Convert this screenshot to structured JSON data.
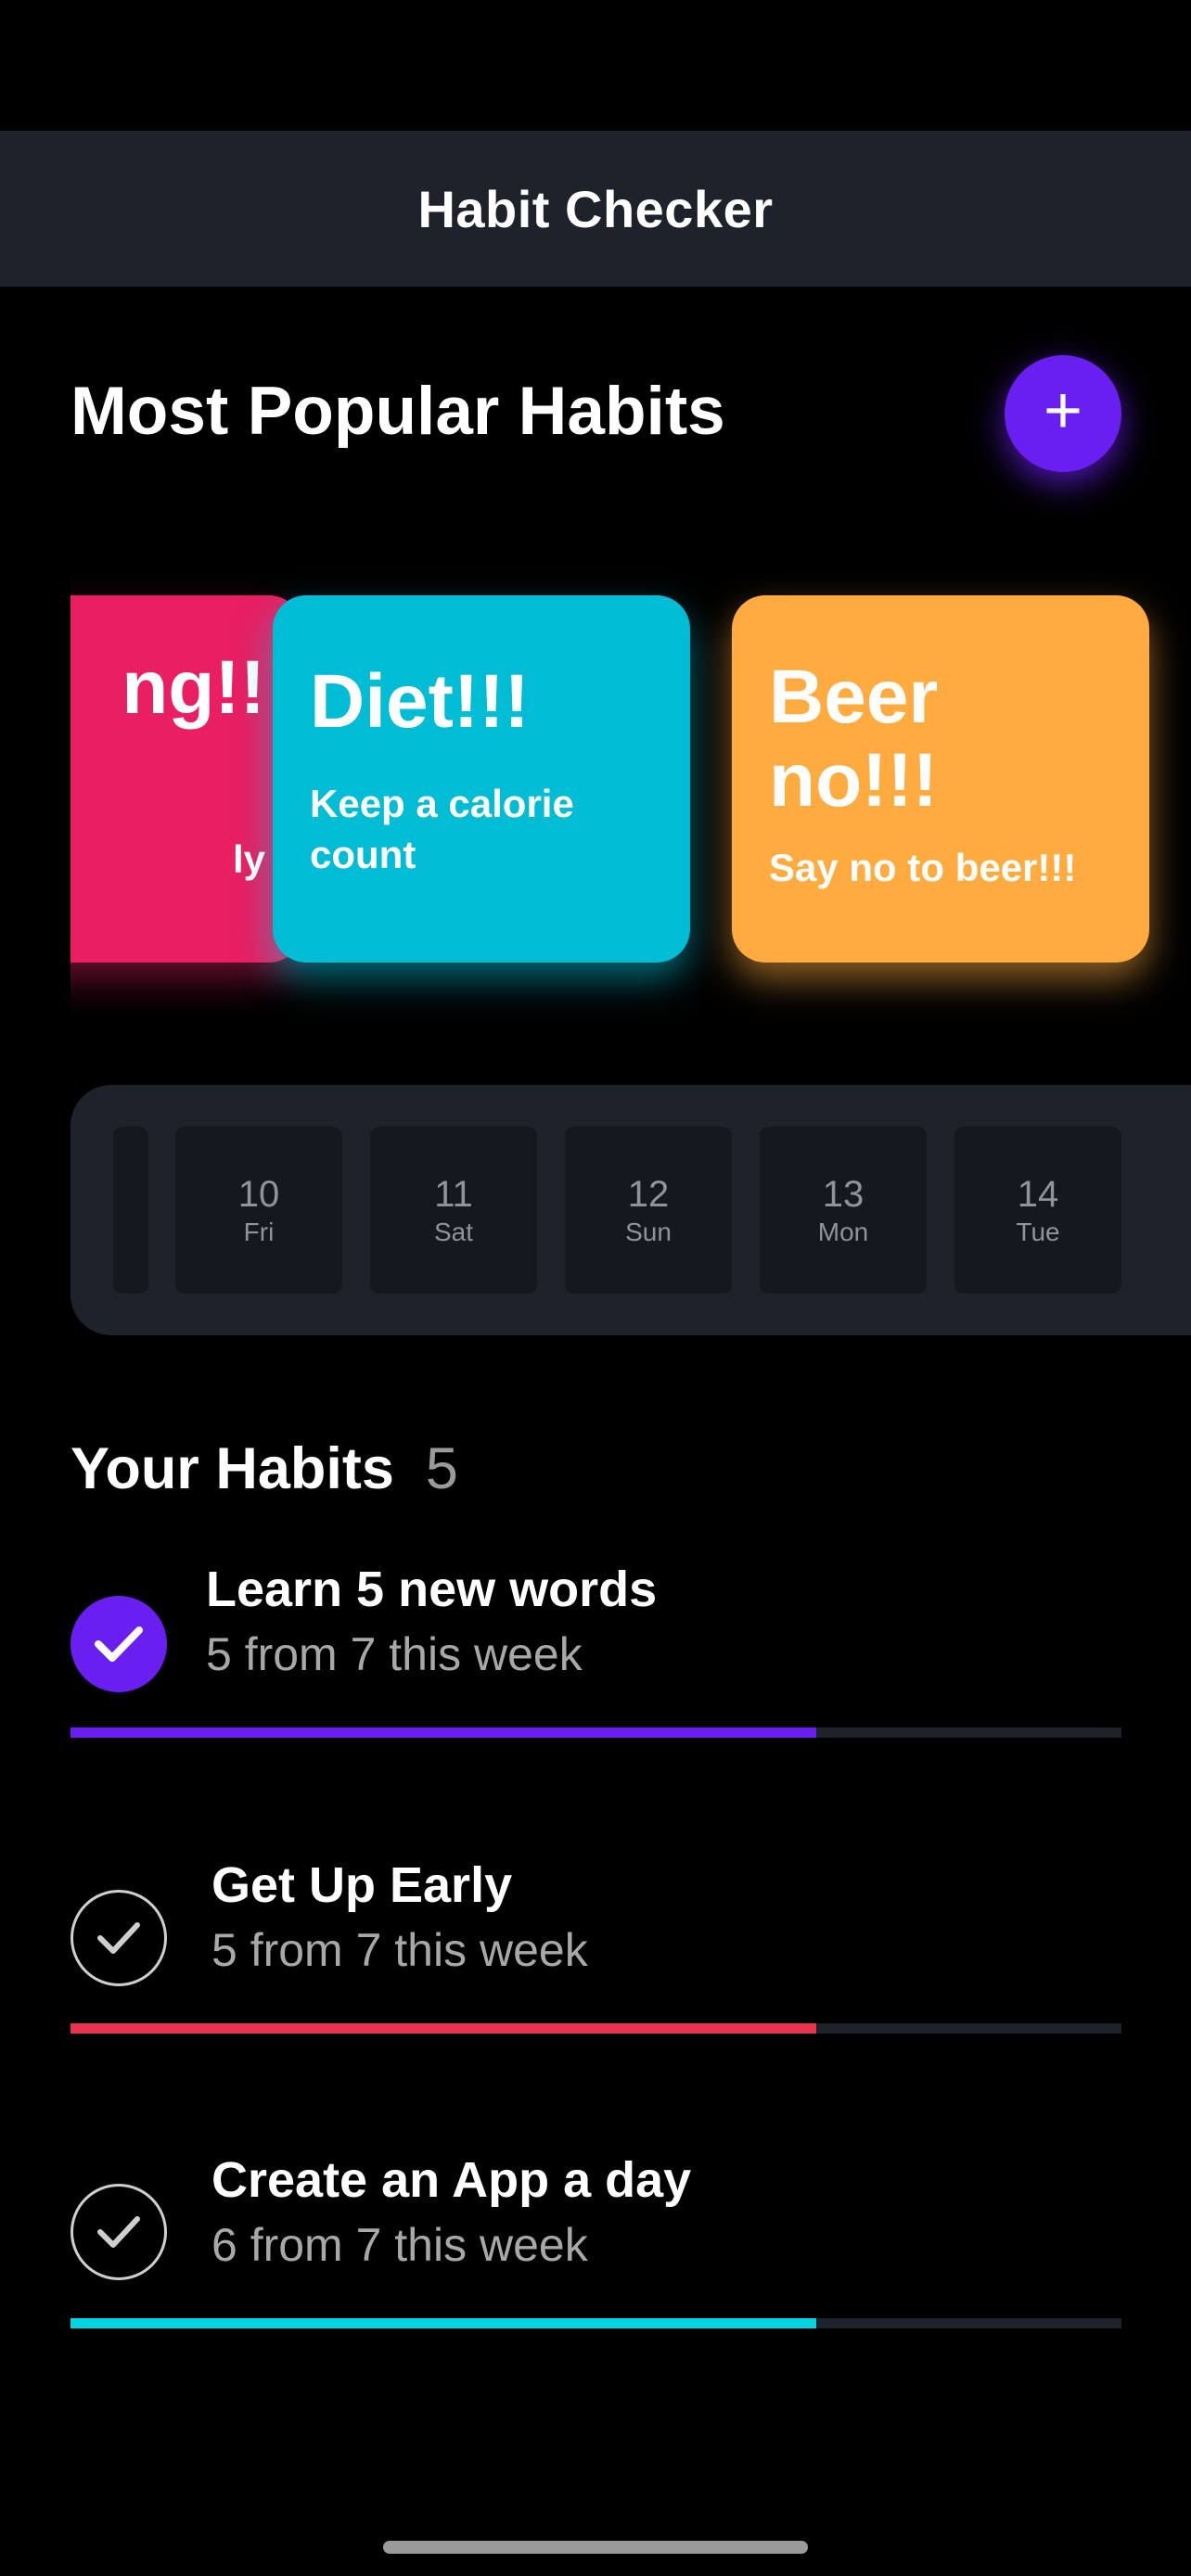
{
  "app": {
    "title": "Habit Checker"
  },
  "popular": {
    "title": "Most Popular Habits",
    "add_icon": "plus-icon",
    "cards": [
      {
        "title": "ng!!",
        "description": "ly",
        "color": "#e91e63"
      },
      {
        "title": "Diet!!!",
        "description": "Keep a calorie count",
        "color": "#00bcd4"
      },
      {
        "title": "Beer no!!!",
        "description": "Say no to beer!!!",
        "color": "#ffab40"
      }
    ]
  },
  "dates": [
    {
      "num": "10",
      "day": "Fri"
    },
    {
      "num": "11",
      "day": "Sat"
    },
    {
      "num": "12",
      "day": "Sun"
    },
    {
      "num": "13",
      "day": "Mon"
    },
    {
      "num": "14",
      "day": "Tue"
    }
  ],
  "habits": {
    "title": "Your Habits",
    "count": "5",
    "items": [
      {
        "name": "Learn 5 new words",
        "subtitle": "5 from 7 this week",
        "completed": true,
        "progress": 0.71,
        "color": "#6a1ff1"
      },
      {
        "name": "Get Up Early",
        "subtitle": "5 from 7 this week",
        "completed": false,
        "progress": 0.71,
        "color": "#e8344e"
      },
      {
        "name": "Create an App a day",
        "subtitle": "6 from 7 this week",
        "completed": false,
        "progress": 0.71,
        "color": "#00d4e0"
      }
    ]
  }
}
